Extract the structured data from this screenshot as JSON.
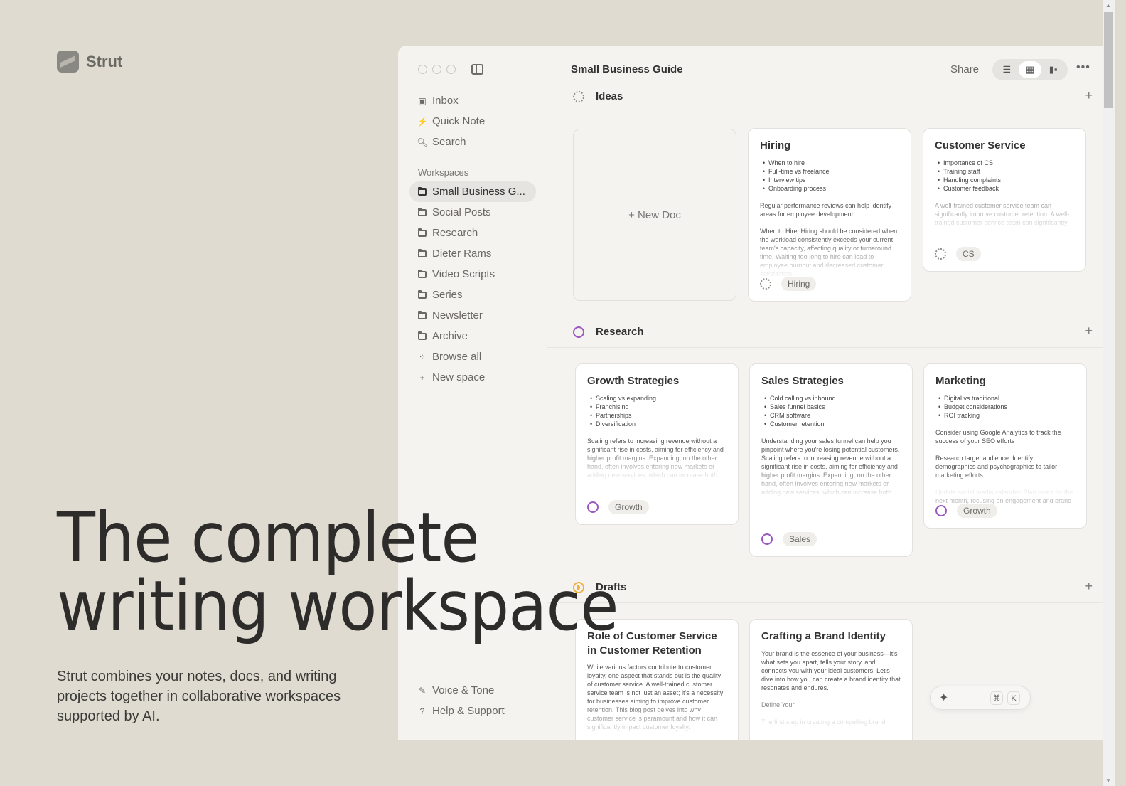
{
  "brand": {
    "name": "Strut",
    "icon": "strut-logo"
  },
  "hero": {
    "line1": "The complete",
    "line2": "writing workspace",
    "subtext": "Strut combines your notes, docs, and writing projects together in collaborative workspaces supported by AI."
  },
  "sidebar": {
    "top_items": [
      {
        "label": "Inbox",
        "icon": "inbox-icon"
      },
      {
        "label": "Quick Note",
        "icon": "lightning-icon"
      },
      {
        "label": "Search",
        "icon": "search-icon"
      }
    ],
    "workspaces_label": "Workspaces",
    "workspaces": [
      {
        "label": "Small Business G...",
        "active": true
      },
      {
        "label": "Social Posts"
      },
      {
        "label": "Research"
      },
      {
        "label": "Dieter Rams"
      },
      {
        "label": "Video Scripts"
      },
      {
        "label": "Series"
      },
      {
        "label": "Newsletter"
      },
      {
        "label": "Archive"
      }
    ],
    "browse_all": "Browse all",
    "new_space": "New space",
    "bottom_items": [
      {
        "label": "Voice & Tone",
        "icon": "pen-icon"
      },
      {
        "label": "Help & Support",
        "icon": "help-icon"
      }
    ]
  },
  "topbar": {
    "title": "Small Business Guide",
    "share": "Share",
    "views": [
      "list-view",
      "grid-view",
      "board-view"
    ],
    "active_view": "grid-view",
    "more": "•••"
  },
  "sections": [
    {
      "title": "Ideas",
      "icon_color": "#8e8c88",
      "new_doc": "New Doc",
      "cards": [
        {
          "title": "Hiring",
          "bullets": [
            "When to hire",
            "Full-time vs freelance",
            "Interview tips",
            "Onboarding process"
          ],
          "paragraphs": [
            "Regular performance reviews can help identify areas for employee development.",
            "When to Hire: Hiring should be considered when the workload consistently exceeds your current team's capacity, affecting quality or turnaround time. Waiting too long to hire can lead to employee burnout and decreased customer satisfaction."
          ],
          "tag": "Hiring"
        },
        {
          "title": "Customer Service",
          "bullets": [
            "Importance of CS",
            "Training staff",
            "Handling complaints",
            "Customer feedback"
          ],
          "paragraphs": [
            "A well-trained customer service team can significantly improve customer retention. A well-trained customer service team can significantly"
          ],
          "tag": "CS"
        }
      ]
    },
    {
      "title": "Research",
      "icon_color": "#9b59c2",
      "cards": [
        {
          "title": "Growth Strategies",
          "bullets": [
            "Scaling vs expanding",
            "Franchising",
            "Partnerships",
            "Diversification"
          ],
          "paragraphs": [
            "Scaling refers to increasing revenue without a significant rise in costs, aiming for efficiency and higher profit margins. Expanding, on the other hand, often involves entering new markets or adding new services, which can increase both"
          ],
          "tag": "Growth"
        },
        {
          "title": "Sales Strategies",
          "bullets": [
            "Cold calling vs inbound",
            "Sales funnel basics",
            "CRM software",
            "Customer retention"
          ],
          "paragraphs": [
            "Understanding your sales funnel can help you pinpoint where you're losing potential customers. Scaling refers to increasing revenue without a significant rise in costs, aiming for efficiency and higher profit margins. Expanding, on the other hand, often involves entering new markets or adding new services, which can increase both"
          ],
          "tag": "Sales"
        },
        {
          "title": "Marketing",
          "bullets": [
            "Digital vs traditional",
            "Budget considerations",
            "ROI tracking"
          ],
          "paragraphs": [
            "Consider using Google Analytics to track the success of your SEO efforts",
            "Research target audience: Identify demographics and psychographics to tailor marketing efforts.",
            "Update social media calendar: Plan posts for the next month, focusing on engagement and brand"
          ],
          "tag": "Growth"
        }
      ]
    },
    {
      "title": "Drafts",
      "icon_color": "#f0b040",
      "cards": [
        {
          "title": "Role of Customer Service in Customer Retention",
          "paragraphs": [
            "While various factors contribute to customer loyalty, one aspect that stands out is the quality of customer service. A well-trained customer service team is not just an asset; it's a necessity for businesses aiming to improve customer retention. This blog post delves into why customer service is paramount and how it can significantly impact customer loyalty."
          ]
        },
        {
          "title": "Crafting a Brand Identity",
          "paragraphs": [
            "Your brand is the essence of your business—it's what sets you apart, tells your story, and connects you with your ideal customers. Let's dive into how you can create a brand identity that resonates and endures.",
            "Define Your",
            "The first step in creating a compelling brand"
          ]
        }
      ]
    }
  ],
  "command_bar": {
    "icon": "sparkle-icon",
    "key1": "⌘",
    "key2": "K"
  }
}
